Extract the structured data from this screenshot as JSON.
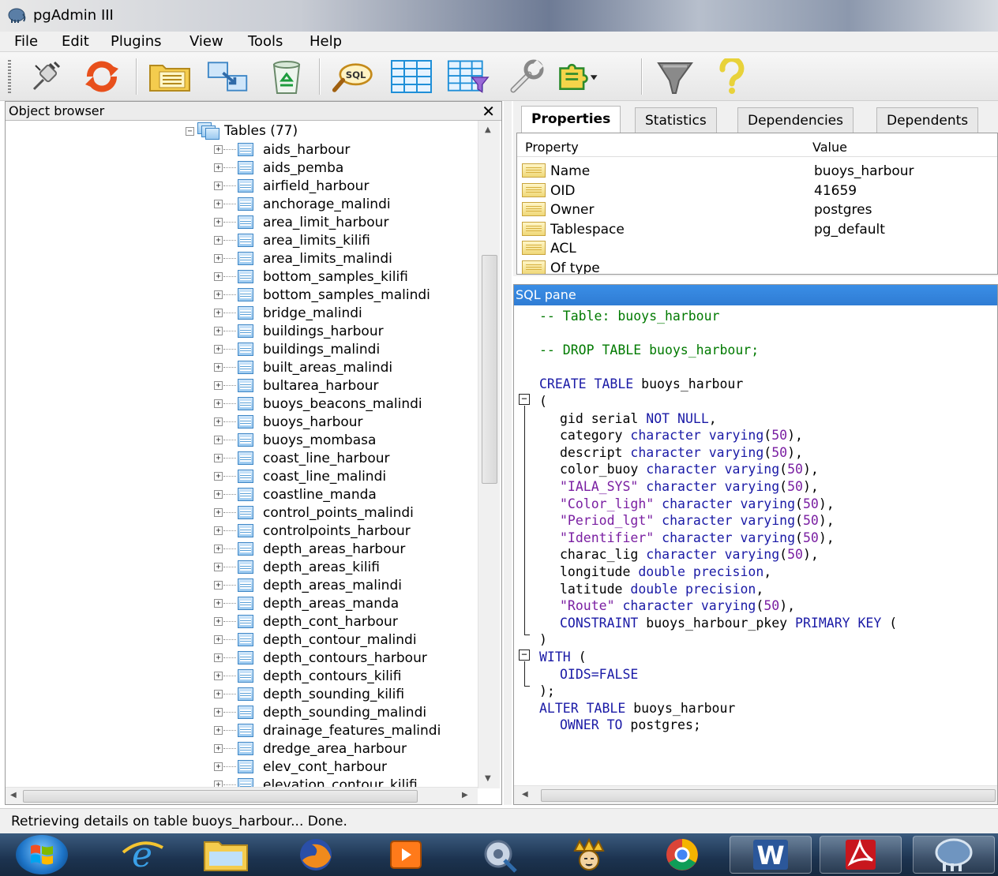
{
  "window": {
    "title": "pgAdmin III"
  },
  "menu": [
    "File",
    "Edit",
    "Plugins",
    "View",
    "Tools",
    "Help"
  ],
  "toolbar": {
    "buttons": [
      "connect",
      "refresh",
      "properties",
      "create-object",
      "drop",
      "sql-query",
      "view-data",
      "filtered-data",
      "maintenance",
      "plugins",
      "guru-hints",
      "help"
    ],
    "sql_label": "SQL"
  },
  "object_browser": {
    "title": "Object browser",
    "close": "✕",
    "root_label": "Tables (77)",
    "items": [
      "aids_harbour",
      "aids_pemba",
      "airfield_harbour",
      "anchorage_malindi",
      "area_limit_harbour",
      "area_limits_kilifi",
      "area_limits_malindi",
      "bottom_samples_kilifi",
      "bottom_samples_malindi",
      "bridge_malindi",
      "buildings_harbour",
      "buildings_malindi",
      "built_areas_malindi",
      "bultarea_harbour",
      "buoys_beacons_malindi",
      "buoys_harbour",
      "buoys_mombasa",
      "coast_line_harbour",
      "coast_line_malindi",
      "coastline_manda",
      "control_points_malindi",
      "controlpoints_harbour",
      "depth_areas_harbour",
      "depth_areas_kilifi",
      "depth_areas_malindi",
      "depth_areas_manda",
      "depth_cont_harbour",
      "depth_contour_malindi",
      "depth_contours_harbour",
      "depth_contours_kilifi",
      "depth_sounding_kilifi",
      "depth_sounding_malindi",
      "drainage_features_malindi",
      "dredge_area_harbour",
      "elev_cont_harbour",
      "elevation_contour_kilifi"
    ],
    "selected": "buoys_harbour"
  },
  "properties": {
    "tabs": [
      "Properties",
      "Statistics",
      "Dependencies",
      "Dependents"
    ],
    "active_tab": "Properties",
    "col_property": "Property",
    "col_value": "Value",
    "rows": [
      {
        "name": "Name",
        "value": "buoys_harbour"
      },
      {
        "name": "OID",
        "value": "41659"
      },
      {
        "name": "Owner",
        "value": "postgres"
      },
      {
        "name": "Tablespace",
        "value": "pg_default"
      },
      {
        "name": "ACL",
        "value": ""
      },
      {
        "name": "Of type",
        "value": ""
      }
    ]
  },
  "sql_pane": {
    "title": "SQL pane",
    "lines": [
      {
        "indent": 0,
        "parts": [
          [
            "cm",
            "-- Table: buoys_harbour"
          ]
        ]
      },
      {
        "indent": 0,
        "parts": []
      },
      {
        "indent": 0,
        "parts": [
          [
            "cm",
            "-- DROP TABLE buoys_harbour;"
          ]
        ]
      },
      {
        "indent": 0,
        "parts": []
      },
      {
        "indent": 0,
        "parts": [
          [
            "kw",
            "CREATE TABLE"
          ],
          [
            "",
            " buoys_harbour"
          ]
        ]
      },
      {
        "indent": 0,
        "parts": [
          [
            "",
            "("
          ]
        ]
      },
      {
        "indent": 1,
        "parts": [
          [
            "",
            "gid serial "
          ],
          [
            "kw",
            "NOT NULL"
          ],
          [
            "",
            ","
          ]
        ]
      },
      {
        "indent": 1,
        "parts": [
          [
            "",
            "category "
          ],
          [
            "kw",
            "character varying"
          ],
          [
            "",
            "("
          ],
          [
            "num",
            "50"
          ],
          [
            "",
            "),"
          ]
        ]
      },
      {
        "indent": 1,
        "parts": [
          [
            "",
            "descript "
          ],
          [
            "kw",
            "character varying"
          ],
          [
            "",
            "("
          ],
          [
            "num",
            "50"
          ],
          [
            "",
            "),"
          ]
        ]
      },
      {
        "indent": 1,
        "parts": [
          [
            "",
            "color_buoy "
          ],
          [
            "kw",
            "character varying"
          ],
          [
            "",
            "("
          ],
          [
            "num",
            "50"
          ],
          [
            "",
            "),"
          ]
        ]
      },
      {
        "indent": 1,
        "parts": [
          [
            "str",
            "\"IALA_SYS\""
          ],
          [
            "",
            " "
          ],
          [
            "kw",
            "character varying"
          ],
          [
            "",
            "("
          ],
          [
            "num",
            "50"
          ],
          [
            "",
            "),"
          ]
        ]
      },
      {
        "indent": 1,
        "parts": [
          [
            "str",
            "\"Color_ligh\""
          ],
          [
            "",
            " "
          ],
          [
            "kw",
            "character varying"
          ],
          [
            "",
            "("
          ],
          [
            "num",
            "50"
          ],
          [
            "",
            "),"
          ]
        ]
      },
      {
        "indent": 1,
        "parts": [
          [
            "str",
            "\"Period_lgt\""
          ],
          [
            "",
            " "
          ],
          [
            "kw",
            "character varying"
          ],
          [
            "",
            "("
          ],
          [
            "num",
            "50"
          ],
          [
            "",
            "),"
          ]
        ]
      },
      {
        "indent": 1,
        "parts": [
          [
            "str",
            "\"Identifier\""
          ],
          [
            "",
            " "
          ],
          [
            "kw",
            "character varying"
          ],
          [
            "",
            "("
          ],
          [
            "num",
            "50"
          ],
          [
            "",
            "),"
          ]
        ]
      },
      {
        "indent": 1,
        "parts": [
          [
            "",
            "charac_lig "
          ],
          [
            "kw",
            "character varying"
          ],
          [
            "",
            "("
          ],
          [
            "num",
            "50"
          ],
          [
            "",
            "),"
          ]
        ]
      },
      {
        "indent": 1,
        "parts": [
          [
            "",
            "longitude "
          ],
          [
            "kw",
            "double precision"
          ],
          [
            "",
            ","
          ]
        ]
      },
      {
        "indent": 1,
        "parts": [
          [
            "",
            "latitude "
          ],
          [
            "kw",
            "double precision"
          ],
          [
            "",
            ","
          ]
        ]
      },
      {
        "indent": 1,
        "parts": [
          [
            "str",
            "\"Route\""
          ],
          [
            "",
            " "
          ],
          [
            "kw",
            "character varying"
          ],
          [
            "",
            "("
          ],
          [
            "num",
            "50"
          ],
          [
            "",
            "),"
          ]
        ]
      },
      {
        "indent": 1,
        "parts": [
          [
            "kw",
            "CONSTRAINT"
          ],
          [
            "",
            " buoys_harbour_pkey "
          ],
          [
            "kw",
            "PRIMARY KEY"
          ],
          [
            "",
            " ("
          ]
        ]
      },
      {
        "indent": 0,
        "parts": [
          [
            "",
            ")"
          ]
        ]
      },
      {
        "indent": 0,
        "parts": [
          [
            "kw",
            "WITH"
          ],
          [
            "",
            " ("
          ]
        ]
      },
      {
        "indent": 1,
        "parts": [
          [
            "kw",
            "OIDS=FALSE"
          ]
        ]
      },
      {
        "indent": 0,
        "parts": [
          [
            "",
            ");"
          ]
        ]
      },
      {
        "indent": 0,
        "parts": [
          [
            "kw",
            "ALTER TABLE"
          ],
          [
            "",
            " buoys_harbour"
          ]
        ]
      },
      {
        "indent": 1,
        "parts": [
          [
            "kw",
            "OWNER TO"
          ],
          [
            "",
            " postgres;"
          ]
        ]
      }
    ]
  },
  "status": {
    "text": "Retrieving details on table buoys_harbour... Done."
  },
  "taskbar": {
    "items": [
      "start",
      "internet-explorer",
      "file-explorer",
      "firefox",
      "media-player",
      "control-panel",
      "king-game",
      "chrome",
      "word",
      "acrobat",
      "pgadmin"
    ],
    "word_letter": "W"
  }
}
